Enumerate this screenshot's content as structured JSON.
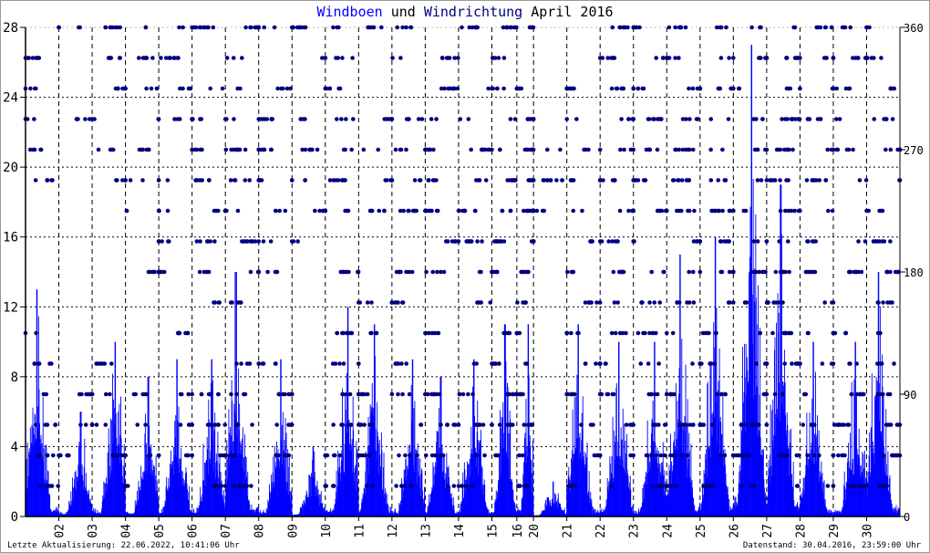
{
  "chart_data": {
    "type": "bar",
    "title_parts": [
      "Windboen",
      "und",
      "Windrichtung",
      "April 2016"
    ],
    "xlabel": "",
    "ylabel_left": "Windboen",
    "ylabel_right": "Windrichtung",
    "ylim_left": [
      0,
      28
    ],
    "ylim_right": [
      0,
      360
    ],
    "y_ticks_left": [
      "0",
      "4",
      "8",
      "12",
      "16",
      "20",
      "24",
      "28"
    ],
    "y_ticks_right": [
      "0",
      "90",
      "180",
      "270",
      "360"
    ],
    "x_range_hours": [
      0,
      630
    ],
    "x_ticks": [
      {
        "label": "02",
        "h": 24
      },
      {
        "label": "03",
        "h": 48
      },
      {
        "label": "04",
        "h": 72
      },
      {
        "label": "05",
        "h": 96
      },
      {
        "label": "06",
        "h": 120
      },
      {
        "label": "07",
        "h": 144
      },
      {
        "label": "08",
        "h": 168
      },
      {
        "label": "09",
        "h": 192
      },
      {
        "label": "10",
        "h": 216
      },
      {
        "label": "11",
        "h": 240
      },
      {
        "label": "12",
        "h": 264
      },
      {
        "label": "13",
        "h": 288
      },
      {
        "label": "14",
        "h": 312
      },
      {
        "label": "15",
        "h": 336
      },
      {
        "label": "16",
        "h": 354
      },
      {
        "label": "20",
        "h": 366
      },
      {
        "label": "21",
        "h": 390
      },
      {
        "label": "22",
        "h": 414
      },
      {
        "label": "23",
        "h": 438
      },
      {
        "label": "24",
        "h": 462
      },
      {
        "label": "25",
        "h": 486
      },
      {
        "label": "26",
        "h": 510
      },
      {
        "label": "27",
        "h": 534
      },
      {
        "label": "28",
        "h": 558
      },
      {
        "label": "29",
        "h": 582
      },
      {
        "label": "30",
        "h": 606
      }
    ],
    "grid": true,
    "series": [
      {
        "name": "Windboen",
        "color": "#0000ff",
        "unit": "m/s",
        "daily_max": [
          13,
          6,
          10,
          8,
          9,
          9,
          14,
          9,
          4,
          12,
          11,
          9,
          8,
          9,
          11,
          11,
          2,
          11,
          10,
          10,
          15,
          16,
          27,
          19,
          10,
          10,
          14
        ]
      },
      {
        "name": "Windrichtung",
        "color": "#000080",
        "unit": "deg",
        "daily_directions": [
          [
            22.5,
            45,
            67.5,
            90,
            112.5,
            135,
            247.5,
            270,
            292.5,
            315,
            337.5,
            360
          ],
          [
            45,
            67.5,
            90,
            292.5,
            360
          ],
          [
            45,
            67.5,
            90,
            112.5,
            247.5,
            270,
            292.5,
            315,
            337.5,
            360
          ],
          [
            22.5,
            45,
            67.5,
            90,
            180,
            202.5,
            225,
            247.5,
            270,
            292.5,
            315,
            337.5,
            360
          ],
          [
            45,
            67.5,
            90,
            135,
            180,
            202.5,
            225,
            247.5,
            292.5,
            315,
            337.5,
            360
          ],
          [
            22.5,
            45,
            67.5,
            90,
            157.5,
            180,
            202.5,
            225,
            247.5,
            270,
            292.5,
            315,
            360
          ],
          [
            22.5,
            45,
            67.5,
            90,
            112.5,
            157.5,
            180,
            202.5,
            225,
            247.5,
            270,
            292.5,
            315,
            337.5,
            360
          ],
          [
            45,
            67.5,
            90,
            112.5,
            180,
            202.5,
            225,
            247.5,
            270,
            292.5,
            315,
            360
          ],
          [
            202.5,
            225,
            247.5,
            270,
            292.5,
            337.5,
            360
          ],
          [
            22.5,
            45,
            67.5,
            90,
            112.5,
            135,
            180,
            225,
            247.5,
            270,
            292.5,
            315,
            337.5,
            360
          ],
          [
            22.5,
            45,
            67.5,
            90,
            112.5,
            135,
            157.5,
            225,
            247.5,
            270,
            292.5,
            360
          ],
          [
            22.5,
            45,
            67.5,
            90,
            112.5,
            157.5,
            180,
            225,
            247.5,
            270,
            292.5,
            337.5,
            360
          ],
          [
            22.5,
            45,
            67.5,
            90,
            135,
            180,
            202.5,
            225,
            247.5,
            270,
            292.5,
            315,
            337.5
          ],
          [
            22.5,
            45,
            67.5,
            90,
            112.5,
            157.5,
            180,
            202.5,
            225,
            247.5,
            270,
            292.5,
            315,
            360
          ],
          [
            45,
            67.5,
            90,
            112.5,
            135,
            180,
            202.5,
            225,
            247.5,
            270,
            292.5,
            315,
            337.5,
            360
          ],
          [
            22.5,
            45,
            67.5,
            90,
            112.5,
            135,
            157.5,
            180,
            202.5,
            225,
            247.5,
            270,
            292.5,
            315,
            360
          ],
          [
            225,
            247.5,
            270
          ],
          [
            22.5,
            45,
            67.5,
            90,
            112.5,
            135,
            157.5,
            180,
            202.5,
            225,
            247.5,
            270,
            292.5,
            315
          ],
          [
            22.5,
            45,
            67.5,
            90,
            112.5,
            135,
            157.5,
            180,
            202.5,
            225,
            247.5,
            270,
            292.5,
            315,
            337.5,
            360
          ],
          [
            22.5,
            45,
            67.5,
            90,
            112.5,
            135,
            157.5,
            180,
            202.5,
            225,
            247.5,
            270,
            292.5,
            315,
            337.5,
            360
          ],
          [
            22.5,
            45,
            67.5,
            90,
            112.5,
            135,
            157.5,
            180,
            202.5,
            225,
            247.5,
            270,
            292.5,
            315,
            337.5,
            360
          ],
          [
            22.5,
            45,
            67.5,
            90,
            112.5,
            135,
            157.5,
            180,
            202.5,
            225,
            247.5,
            270,
            292.5,
            315,
            337.5,
            360
          ],
          [
            22.5,
            45,
            67.5,
            90,
            112.5,
            135,
            157.5,
            180,
            202.5,
            225,
            247.5,
            270,
            292.5,
            315,
            337.5,
            360
          ],
          [
            22.5,
            45,
            67.5,
            90,
            112.5,
            135,
            157.5,
            180,
            202.5,
            225,
            247.5,
            270,
            292.5,
            315,
            337.5,
            360
          ],
          [
            22.5,
            45,
            67.5,
            90,
            112.5,
            135,
            157.5,
            180,
            202.5,
            225,
            247.5,
            270,
            292.5,
            315,
            337.5,
            360
          ],
          [
            22.5,
            45,
            67.5,
            90,
            112.5,
            135,
            180,
            202.5,
            247.5,
            270,
            292.5,
            315,
            337.5,
            360
          ],
          [
            22.5,
            45,
            67.5,
            90,
            112.5,
            135,
            157.5,
            180,
            202.5,
            225,
            247.5,
            270,
            292.5,
            315,
            337.5,
            360
          ]
        ]
      }
    ]
  },
  "footer": {
    "left": "Letzte Aktualisierung: 22.06.2022, 10:41:06 Uhr",
    "right": "Datenstand: 30.04.2016, 23:59:00 Uhr"
  }
}
